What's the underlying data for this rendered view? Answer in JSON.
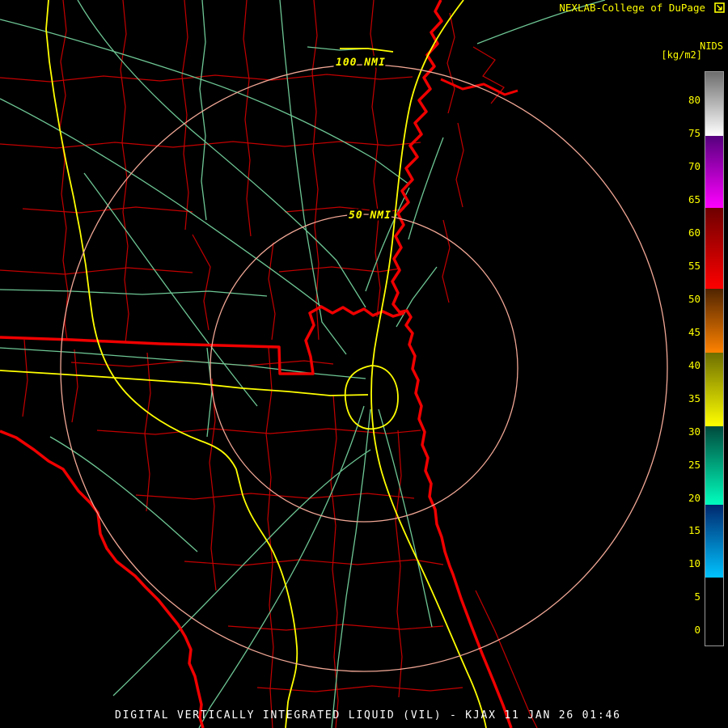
{
  "header": {
    "brand": "NEXLAB-College of DuPage",
    "logo_icon": "cod-arrow-logo-icon",
    "product_code": "NIDS",
    "units_label": "[kg/m2]",
    "text_color": "#FFFF00"
  },
  "colorbar": {
    "units": "kg/m2",
    "tick_color": "#FFFF00",
    "border_color": "#9A9A9A",
    "ticks": [
      "80",
      "75",
      "70",
      "65",
      "60",
      "55",
      "50",
      "45",
      "40",
      "35",
      "30",
      "25",
      "20",
      "15",
      "10",
      "5",
      "0"
    ],
    "segments": [
      {
        "label": "high",
        "from_color": "#6E6E6E",
        "to_color": "#FFFFFF"
      },
      {
        "label": "70s",
        "from_color": "#56007E",
        "to_color": "#FF00FF"
      },
      {
        "label": "55-60s",
        "from_color": "#6E0000",
        "to_color": "#FF0000"
      },
      {
        "label": "45-50s",
        "from_color": "#502400",
        "to_color": "#FF8200"
      },
      {
        "label": "35-40s",
        "from_color": "#6E6E00",
        "to_color": "#FFFF00"
      },
      {
        "label": "20s",
        "from_color": "#004A3C",
        "to_color": "#00FFBE"
      },
      {
        "label": "10s",
        "from_color": "#00286E",
        "to_color": "#00C3FF"
      },
      {
        "label": "low",
        "from_color": "#000000",
        "to_color": "#000000"
      }
    ]
  },
  "map": {
    "outer_ring_label": "100 NMI",
    "inner_ring_label": "50 NMI",
    "ring_color": "#F2A896",
    "county_line_color": "#C40000",
    "state_coast_color": "#F00000",
    "road_color": "#6EC795",
    "interstate_color": "#FFFF00",
    "ocean_color": "#000000"
  },
  "footer": {
    "caption": "DIGITAL VERTICALLY INTEGRATED LIQUID (VIL) - KJAX 11 JAN 26 01:46"
  }
}
